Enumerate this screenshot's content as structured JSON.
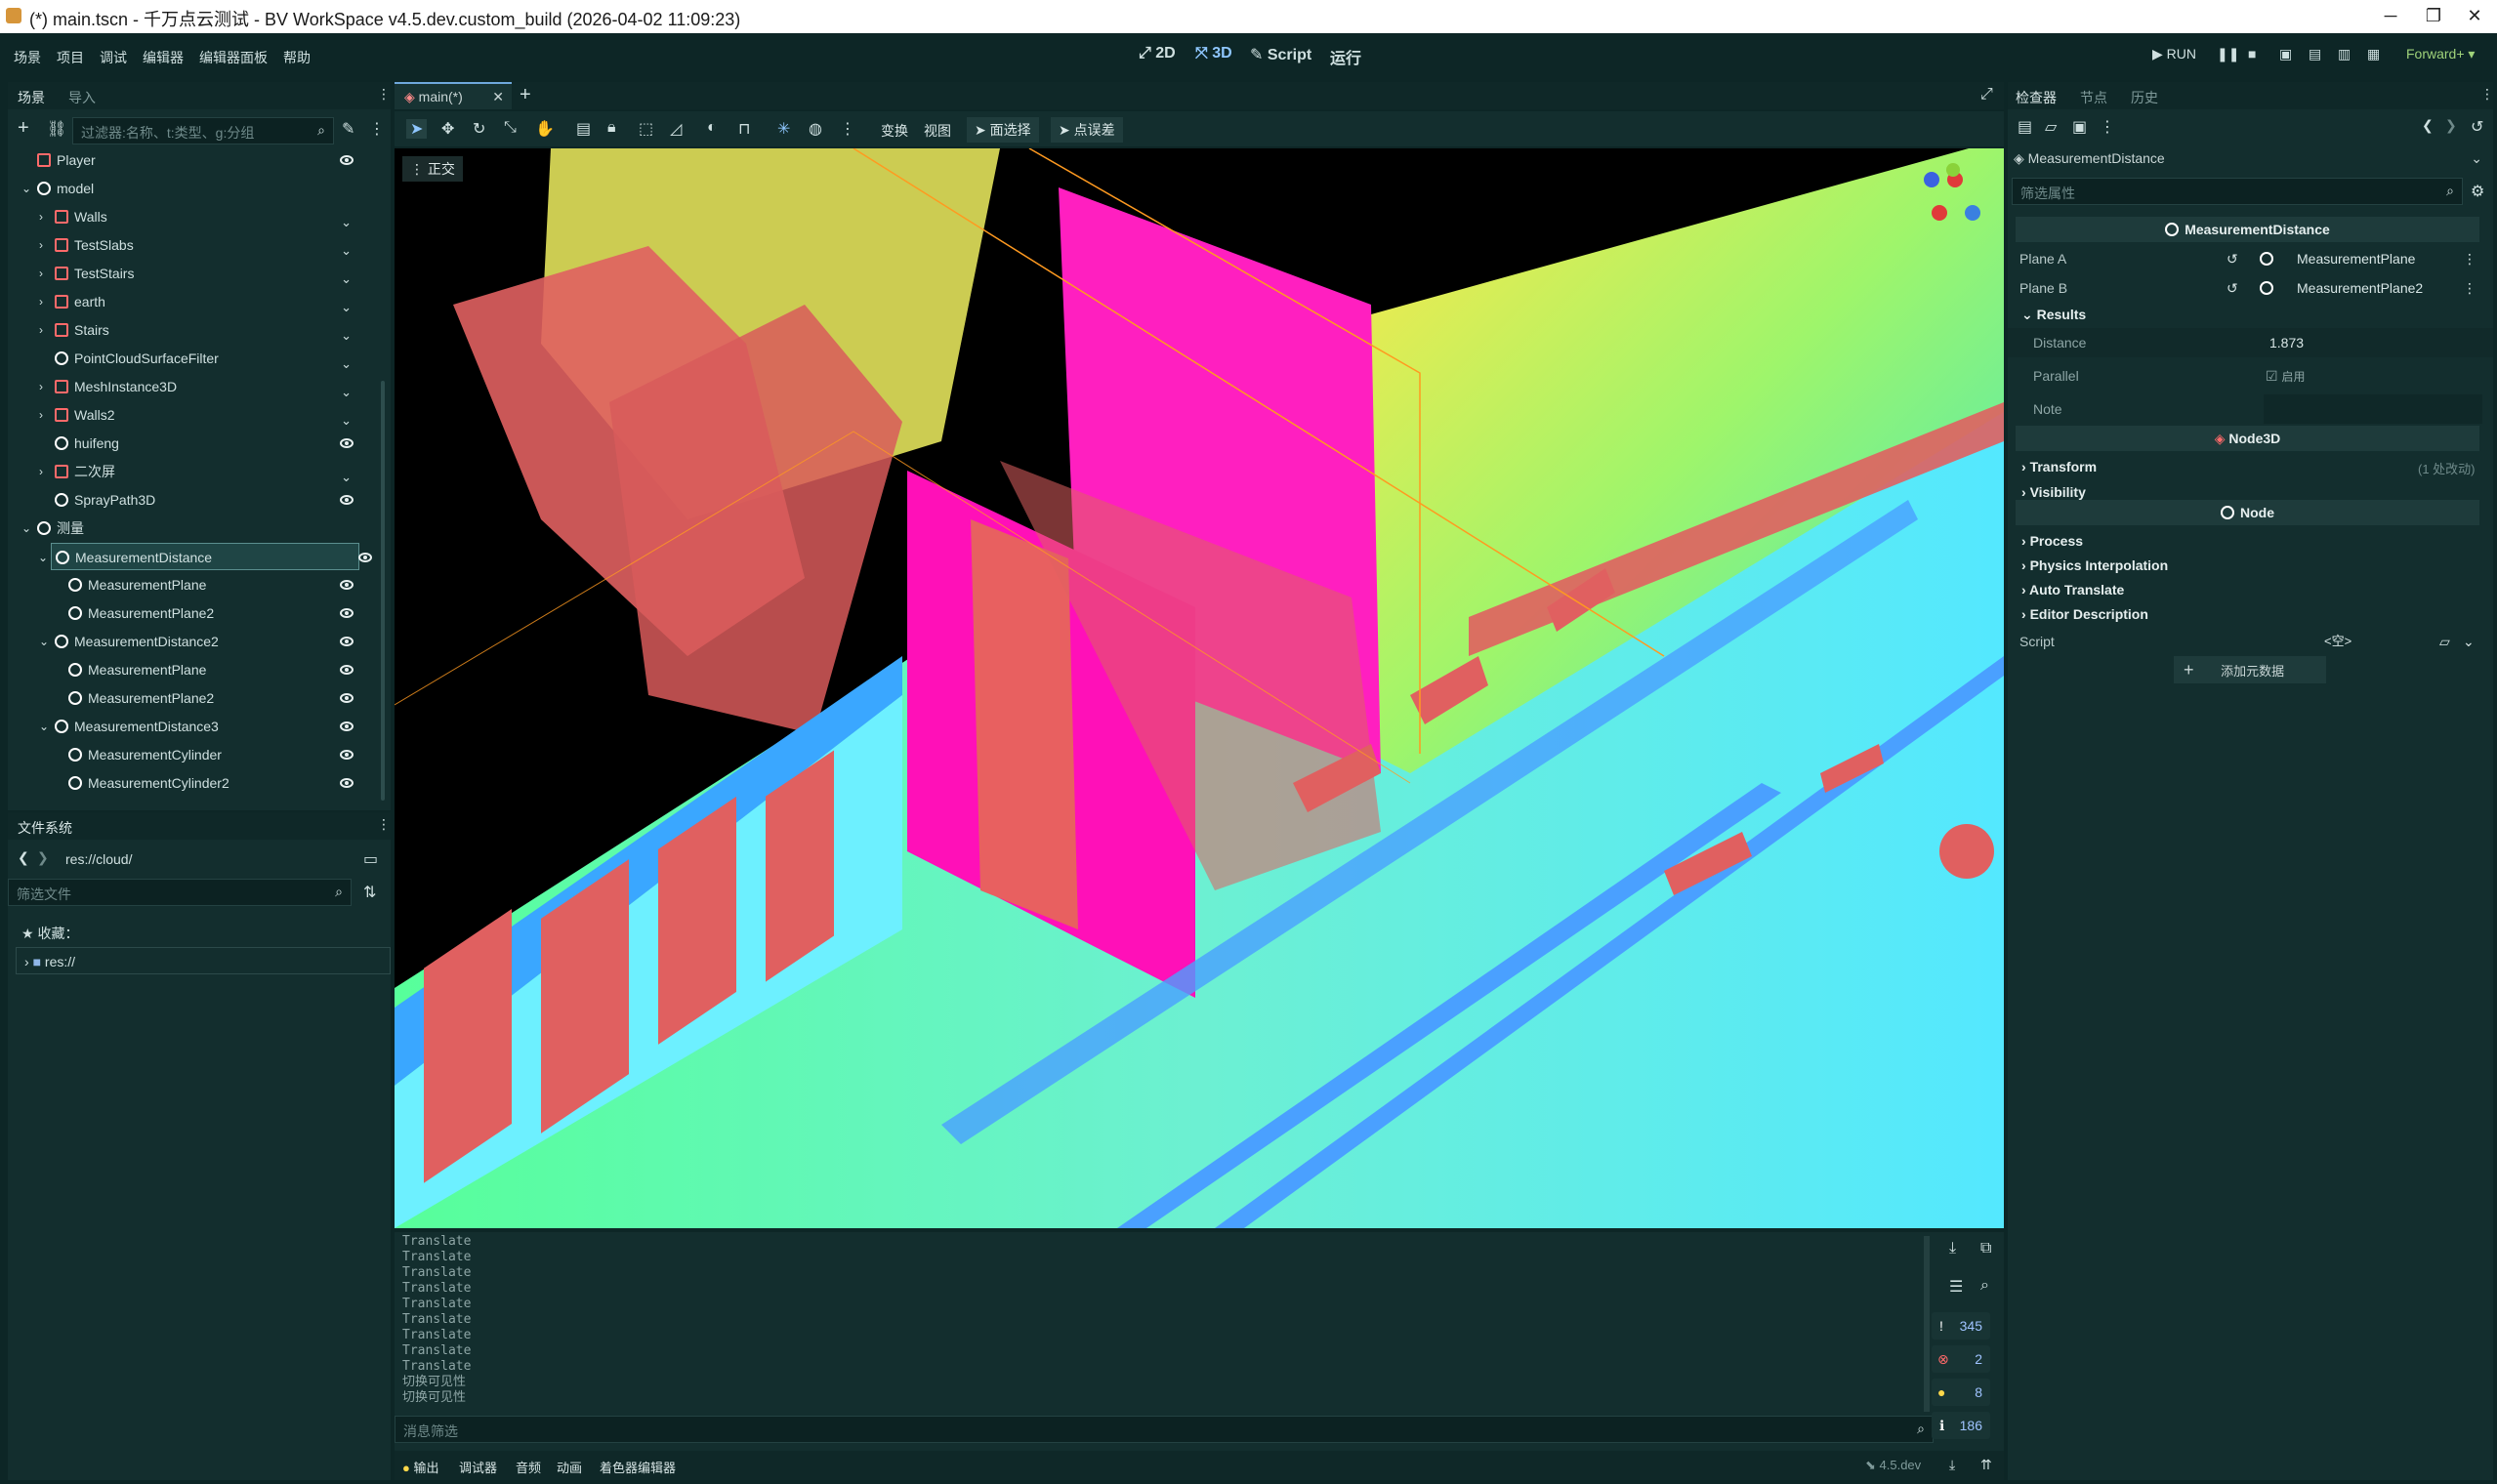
{
  "window": {
    "title": "(*) main.tscn - 千万点云测试 - BV WorkSpace v4.5.dev.custom_build (2026-04-02 11:09:23)",
    "min_glyph": "─",
    "max_glyph": "❐",
    "close_glyph": "✕"
  },
  "menu": {
    "items": [
      "场景",
      "项目",
      "调试",
      "编辑器",
      "编辑器面板",
      "帮助"
    ],
    "modes": [
      "2D",
      "3D",
      "Script",
      "运行"
    ],
    "run_label": "RUN",
    "renderer": "Forward+"
  },
  "scene_dock": {
    "tabs": [
      "场景",
      "导入"
    ],
    "filter_placeholder": "过滤器:名称、t:类型、g:分组",
    "tree": [
      {
        "label": "Player",
        "depth": 1,
        "icon": "red"
      },
      {
        "label": "model",
        "depth": 1,
        "icon": "white"
      },
      {
        "label": "Walls",
        "depth": 2,
        "icon": "red"
      },
      {
        "label": "TestSlabs",
        "depth": 2,
        "icon": "red"
      },
      {
        "label": "TestStairs",
        "depth": 2,
        "icon": "red"
      },
      {
        "label": "earth",
        "depth": 2,
        "icon": "red"
      },
      {
        "label": "Stairs",
        "depth": 2,
        "icon": "red"
      },
      {
        "label": "PointCloudSurfaceFilter",
        "depth": 2,
        "icon": "white"
      },
      {
        "label": "MeshInstance3D",
        "depth": 2,
        "icon": "red"
      },
      {
        "label": "Walls2",
        "depth": 2,
        "icon": "red"
      },
      {
        "label": "huifeng",
        "depth": 2,
        "icon": "white"
      },
      {
        "label": "二次屏",
        "depth": 2,
        "icon": "red"
      },
      {
        "label": "SprayPath3D",
        "depth": 2,
        "icon": "white"
      },
      {
        "label": "测量",
        "depth": 1,
        "icon": "white"
      },
      {
        "label": "MeasurementDistance",
        "depth": 2,
        "icon": "white",
        "selected": true
      },
      {
        "label": "MeasurementPlane",
        "depth": 3,
        "icon": "white"
      },
      {
        "label": "MeasurementPlane2",
        "depth": 3,
        "icon": "white"
      },
      {
        "label": "MeasurementDistance2",
        "depth": 2,
        "icon": "white"
      },
      {
        "label": "MeasurementPlane",
        "depth": 3,
        "icon": "white"
      },
      {
        "label": "MeasurementPlane2",
        "depth": 3,
        "icon": "white"
      },
      {
        "label": "MeasurementDistance3",
        "depth": 2,
        "icon": "white"
      },
      {
        "label": "MeasurementCylinder",
        "depth": 3,
        "icon": "white"
      },
      {
        "label": "MeasurementCylinder2",
        "depth": 3,
        "icon": "white"
      }
    ]
  },
  "filesystem": {
    "tab": "文件系统",
    "path": "res://cloud/",
    "filter_placeholder": "筛选文件",
    "favorites": "收藏：",
    "root": "res://"
  },
  "editor": {
    "tab": "main(*)",
    "toolbar_labels": [
      "变换",
      "视图",
      "面选择",
      "点误差"
    ],
    "view_label": "正交"
  },
  "output": {
    "lines": [
      "Translate",
      "Translate",
      "Translate",
      "Translate",
      "Translate",
      "Translate",
      "Translate",
      "Translate",
      "Translate",
      "切换可见性",
      "切换可见性"
    ],
    "filter_placeholder": "消息筛选",
    "counts": {
      "log": "345",
      "errors": "2",
      "warnings": "8",
      "info": "186"
    },
    "bottom_tabs": [
      "输出",
      "调试器",
      "音频",
      "动画",
      "着色器编辑器"
    ],
    "version": "4.5.dev"
  },
  "inspector": {
    "tabs": [
      "检查器",
      "节点",
      "历史"
    ],
    "object_name": "MeasurementDistance",
    "filter_placeholder": "筛选属性",
    "section_title": "MeasurementDistance",
    "plane_a_label": "Plane A",
    "plane_a_value": "MeasurementPlane",
    "plane_b_label": "Plane B",
    "plane_b_value": "MeasurementPlane2",
    "results_label": "Results",
    "distance_label": "Distance",
    "distance_value": "1.873",
    "parallel_label": "Parallel",
    "parallel_value": "启用",
    "note_label": "Note",
    "node3d_title": "Node3D",
    "transform_label": "Transform",
    "transform_badge": "(1 处改动)",
    "visibility_label": "Visibility",
    "node_title": "Node",
    "groups": [
      "Process",
      "Physics Interpolation",
      "Auto Translate",
      "Editor Description"
    ],
    "script_label": "Script",
    "script_value": "<空>",
    "add_metadata": "添加元数据"
  }
}
